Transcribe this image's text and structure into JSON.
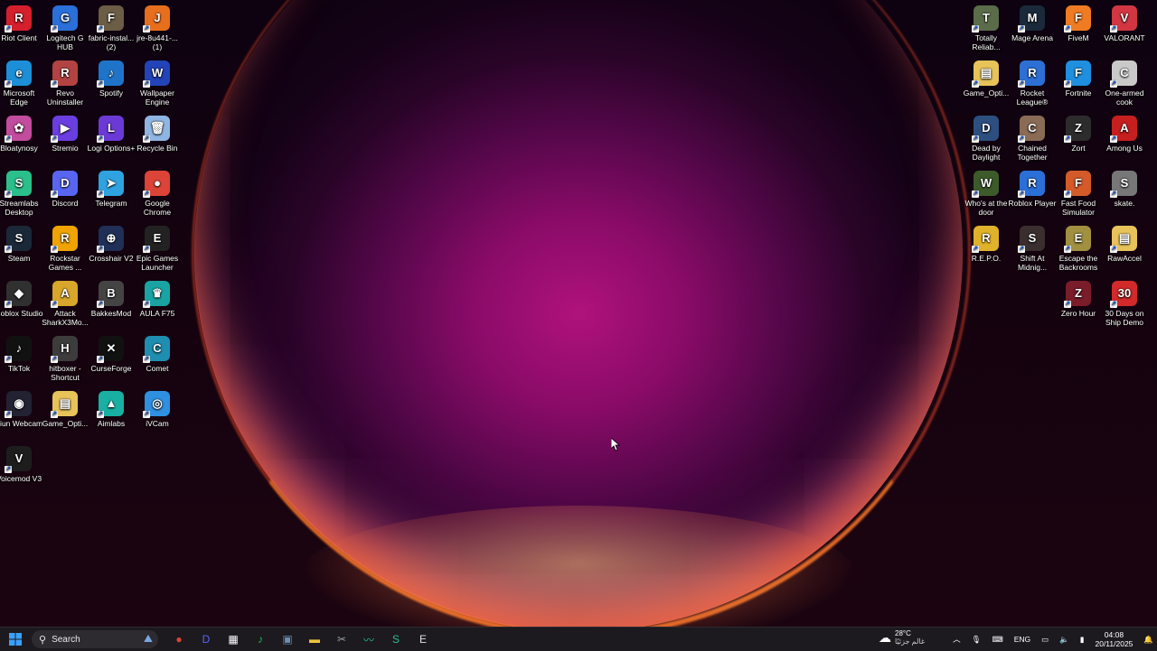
{
  "desktop": {
    "left_icons": [
      {
        "label": "Riot Client",
        "color": "#d51f2c",
        "glyph": "R"
      },
      {
        "label": "Logitech G HUB",
        "color": "#2b6fd8",
        "glyph": "G"
      },
      {
        "label": "fabric-instal... (2)",
        "color": "#6b5d46",
        "glyph": "F"
      },
      {
        "label": "jre-8u441-... (1)",
        "color": "#e76e1c",
        "glyph": "J"
      },
      {
        "label": "Microsoft Edge",
        "color": "#1c8fd6",
        "glyph": "e"
      },
      {
        "label": "Revo Uninstaller",
        "color": "#b34343",
        "glyph": "R"
      },
      {
        "label": "Spotify",
        "color": "#1f74c9",
        "glyph": "♪"
      },
      {
        "label": "Wallpaper Engine",
        "color": "#2343b8",
        "glyph": "W"
      },
      {
        "label": "Bloatynosy",
        "color": "#c24c9d",
        "glyph": "✿"
      },
      {
        "label": "Stremio",
        "color": "#6a3ee0",
        "glyph": "▶"
      },
      {
        "label": "Logi Options+",
        "color": "#6b3ad6",
        "glyph": "L"
      },
      {
        "label": "Recycle Bin",
        "color": "#8fb5e2",
        "glyph": "🗑"
      },
      {
        "label": "Streamlabs Desktop",
        "color": "#2bbf8c",
        "glyph": "S"
      },
      {
        "label": "Discord",
        "color": "#5865f2",
        "glyph": "D"
      },
      {
        "label": "Telegram",
        "color": "#2ea3e0",
        "glyph": "➤"
      },
      {
        "label": "Google Chrome",
        "color": "#db4437",
        "glyph": "●"
      },
      {
        "label": "Steam",
        "color": "#1b2838",
        "glyph": "S"
      },
      {
        "label": "Rockstar Games ...",
        "color": "#f0a400",
        "glyph": "R"
      },
      {
        "label": "Crosshair V2",
        "color": "#1f2f55",
        "glyph": "⊕"
      },
      {
        "label": "Epic Games Launcher",
        "color": "#222222",
        "glyph": "E"
      },
      {
        "label": "Roblox Studio",
        "color": "#303030",
        "glyph": "◆"
      },
      {
        "label": "Attack SharkX3Mo...",
        "color": "#d8a62a",
        "glyph": "A"
      },
      {
        "label": "BakkesMod",
        "color": "#444444",
        "glyph": "B"
      },
      {
        "label": "AULA F75",
        "color": "#1aa3a3",
        "glyph": "♛"
      },
      {
        "label": "TikTok",
        "color": "#111111",
        "glyph": "♪"
      },
      {
        "label": "hitboxer - Shortcut",
        "color": "#3c3c3c",
        "glyph": "H"
      },
      {
        "label": "CurseForge",
        "color": "#111111",
        "glyph": "✕"
      },
      {
        "label": "Comet",
        "color": "#1f8eb0",
        "glyph": "C"
      },
      {
        "label": "Iriun Webcam",
        "color": "#222233",
        "glyph": "◉"
      },
      {
        "label": "Game_Opti...",
        "color": "#e8c35a",
        "glyph": "▤"
      },
      {
        "label": "Aimlabs",
        "color": "#19b0a3",
        "glyph": "▲"
      },
      {
        "label": "iVCam",
        "color": "#2f8fe0",
        "glyph": "◎"
      },
      {
        "label": "Voicemod V3",
        "color": "#1d1d1d",
        "glyph": "V"
      }
    ],
    "right_icons": [
      {
        "label": "Totally Reliab...",
        "color": "#5b6c4b",
        "glyph": "T"
      },
      {
        "label": "Mage Arena",
        "color": "#1a2a3a",
        "glyph": "M"
      },
      {
        "label": "FiveM",
        "color": "#ef7b22",
        "glyph": "F"
      },
      {
        "label": "VALORANT",
        "color": "#d13642",
        "glyph": "V"
      },
      {
        "label": "Game_Opti...",
        "color": "#e8c35a",
        "glyph": "▤"
      },
      {
        "label": "Rocket League®",
        "color": "#2d6fd4",
        "glyph": "R"
      },
      {
        "label": "Fortnite",
        "color": "#1f8fe0",
        "glyph": "F"
      },
      {
        "label": "One-armed cook",
        "color": "#c9c9c9",
        "glyph": "C"
      },
      {
        "label": "Dead by Daylight",
        "color": "#2d4f80",
        "glyph": "D"
      },
      {
        "label": "Chained Together",
        "color": "#8a6b55",
        "glyph": "C"
      },
      {
        "label": "Zort",
        "color": "#2c2c2c",
        "glyph": "Z"
      },
      {
        "label": "Among Us",
        "color": "#c71f1f",
        "glyph": "A"
      },
      {
        "label": "Who's at the door",
        "color": "#3d5a2a",
        "glyph": "W"
      },
      {
        "label": "Roblox Player",
        "color": "#2b6fd8",
        "glyph": "R"
      },
      {
        "label": "Fast Food Simulator",
        "color": "#d55a2a",
        "glyph": "F"
      },
      {
        "label": "skate.",
        "color": "#777777",
        "glyph": "S"
      },
      {
        "label": "R.E.P.O.",
        "color": "#e0b22b",
        "glyph": "R"
      },
      {
        "label": "Shift At Midnig...",
        "color": "#3a2e2e",
        "glyph": "S"
      },
      {
        "label": "Escape the Backrooms",
        "color": "#a09040",
        "glyph": "E"
      },
      {
        "label": "RawAccel",
        "color": "#e8c35a",
        "glyph": "▤"
      },
      {
        "label": "Zero Hour",
        "color": "#7a1c2a",
        "glyph": "Z"
      },
      {
        "label": "30 Days on Ship Demo",
        "color": "#d22a2a",
        "glyph": "30"
      }
    ]
  },
  "taskbar": {
    "search_placeholder": "Search",
    "weather_temp": "28°C",
    "weather_desc": "غالم جزئيًا",
    "lang": "ENG",
    "time": "04:08",
    "date": "20/11/2025",
    "apps": [
      {
        "name": "chrome-icon",
        "glyph": "●",
        "color": "#db4437"
      },
      {
        "name": "discord-icon",
        "glyph": "D",
        "color": "#5865f2"
      },
      {
        "name": "store-icon",
        "glyph": "▦",
        "color": "#ffffff"
      },
      {
        "name": "spotify-icon",
        "glyph": "♪",
        "color": "#1db954"
      },
      {
        "name": "task-app-icon",
        "glyph": "▣",
        "color": "#6b8fb0"
      },
      {
        "name": "file-explorer-icon",
        "glyph": "▬",
        "color": "#f0c33c"
      },
      {
        "name": "snipping-icon",
        "glyph": "✂",
        "color": "#9aa0a6"
      },
      {
        "name": "voicemod-icon",
        "glyph": "〰",
        "color": "#27c29a"
      },
      {
        "name": "streamlabs-icon",
        "glyph": "S",
        "color": "#2bbf8c"
      },
      {
        "name": "epic-icon",
        "glyph": "E",
        "color": "#e0e0e0"
      }
    ]
  }
}
